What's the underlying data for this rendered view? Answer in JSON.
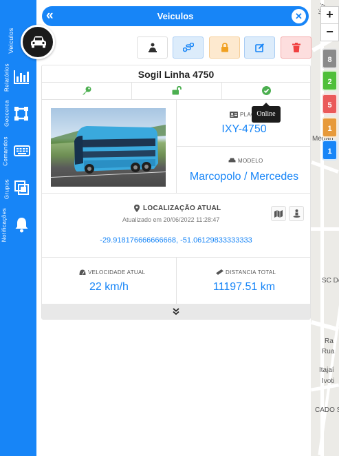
{
  "panel": {
    "title": "Veiculos"
  },
  "sidebar": {
    "items": [
      {
        "label": "Veiculos",
        "icon": "car-icon"
      },
      {
        "label": "Relatórios",
        "icon": "bar-chart-icon"
      },
      {
        "label": "Geocerca",
        "icon": "geofence-icon"
      },
      {
        "label": "Comandos",
        "icon": "keyboard-icon"
      },
      {
        "label": "Grupos",
        "icon": "group-icon"
      },
      {
        "label": "Notificações",
        "icon": "bell-icon"
      }
    ]
  },
  "actions": [
    {
      "name": "driver-button",
      "icon": "driver-icon",
      "color": "#2f2f2f"
    },
    {
      "name": "route-button",
      "icon": "route-icon",
      "color": "#1785f7"
    },
    {
      "name": "lock-button",
      "icon": "lock-icon",
      "color": "#f0a020"
    },
    {
      "name": "edit-button",
      "icon": "edit-icon",
      "color": "#1785f7"
    },
    {
      "name": "delete-button",
      "icon": "trash-icon",
      "color": "#f04040"
    }
  ],
  "vehicle": {
    "name": "Sogil Linha 4750",
    "status_tooltip": "Online",
    "plate_label": "PLACA",
    "plate": "IXY-4750",
    "model_label": "MODELO",
    "model": "Marcopolo / Mercedes",
    "location_label": "LOCALIZAÇÃO ATUAL",
    "updated": "Atualizado em 20/06/2022 11:28:47",
    "coordinates": "-29.918176666666668, -51.06129833333333",
    "speed_label": "VELOCIDADE ATUAL",
    "speed": "22 km/h",
    "distance_label": "DISTANCIA TOTAL",
    "distance": "11197.51 km",
    "expand": "⌄⌄"
  },
  "map": {
    "zoom_in": "+",
    "zoom_out": "−",
    "clusters": [
      {
        "count": "8",
        "color": "#8a8a8a"
      },
      {
        "count": "2",
        "color": "#4fbf3a"
      },
      {
        "count": "5",
        "color": "#ea5a5a"
      },
      {
        "count": "1",
        "color": "#e79a3a"
      },
      {
        "count": "1",
        "color": "#1785f7"
      }
    ],
    "labels": [
      "SC Do",
      "Ra",
      "Rua",
      "Itajaí",
      "Ivoti",
      "CADO S",
      "Medan",
      "ujuí"
    ]
  },
  "colors": {
    "brand": "#1785f7",
    "green": "#4caf50"
  }
}
